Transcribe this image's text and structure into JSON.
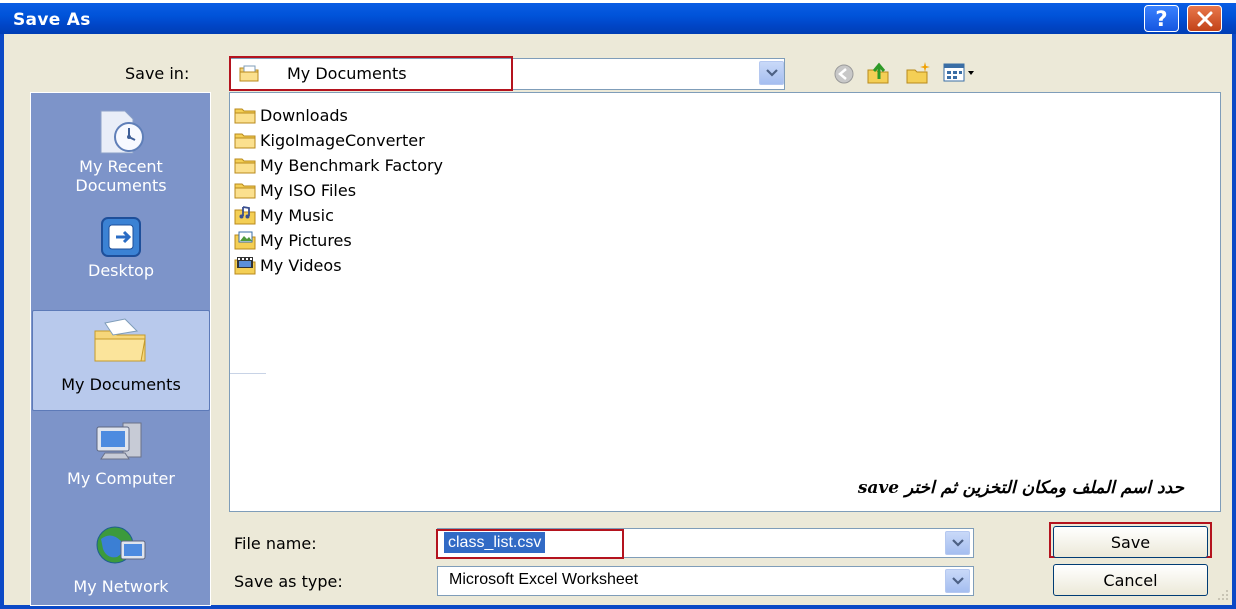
{
  "window": {
    "title": "Save As"
  },
  "title_buttons": {
    "help": "?",
    "close": "X"
  },
  "save_in": {
    "label": "Save in:",
    "value": "My Documents"
  },
  "toolbar": [
    {
      "name": "back-icon"
    },
    {
      "name": "up-folder-icon"
    },
    {
      "name": "new-folder-icon"
    },
    {
      "name": "views-menu-icon"
    }
  ],
  "places": [
    {
      "label_line1": "My Recent",
      "label_line2": "Documents",
      "icon": "recent-documents-icon"
    },
    {
      "label_line1": "Desktop",
      "label_line2": "",
      "icon": "desktop-icon"
    },
    {
      "label_line1": "My Documents",
      "label_line2": "",
      "icon": "my-documents-icon",
      "selected": true
    },
    {
      "label_line1": "My Computer",
      "label_line2": "",
      "icon": "my-computer-icon"
    },
    {
      "label_line1": "My Network",
      "label_line2": "",
      "icon": "my-network-icon"
    }
  ],
  "files": [
    {
      "name": "Downloads",
      "icon": "folder-icon"
    },
    {
      "name": "KigoImageConverter",
      "icon": "folder-icon"
    },
    {
      "name": "My Benchmark Factory",
      "icon": "folder-icon"
    },
    {
      "name": "My ISO Files",
      "icon": "folder-icon"
    },
    {
      "name": "My Music",
      "icon": "music-folder-icon"
    },
    {
      "name": "My Pictures",
      "icon": "pictures-folder-icon"
    },
    {
      "name": "My Videos",
      "icon": "videos-folder-icon"
    }
  ],
  "annotation": "حدد اسم الملف ومكان التخزين ثم اختر save",
  "file_name": {
    "label": "File name:",
    "value": "class_list.csv"
  },
  "save_as_type": {
    "label": "Save as type:",
    "value": "Microsoft Excel Worksheet"
  },
  "buttons": {
    "save": "Save",
    "cancel": "Cancel"
  },
  "colors": {
    "titlebar": "#0053d9",
    "highlight_box": "#b4131e",
    "selection": "#316ac5",
    "dialog_bg": "#ece9d8"
  }
}
